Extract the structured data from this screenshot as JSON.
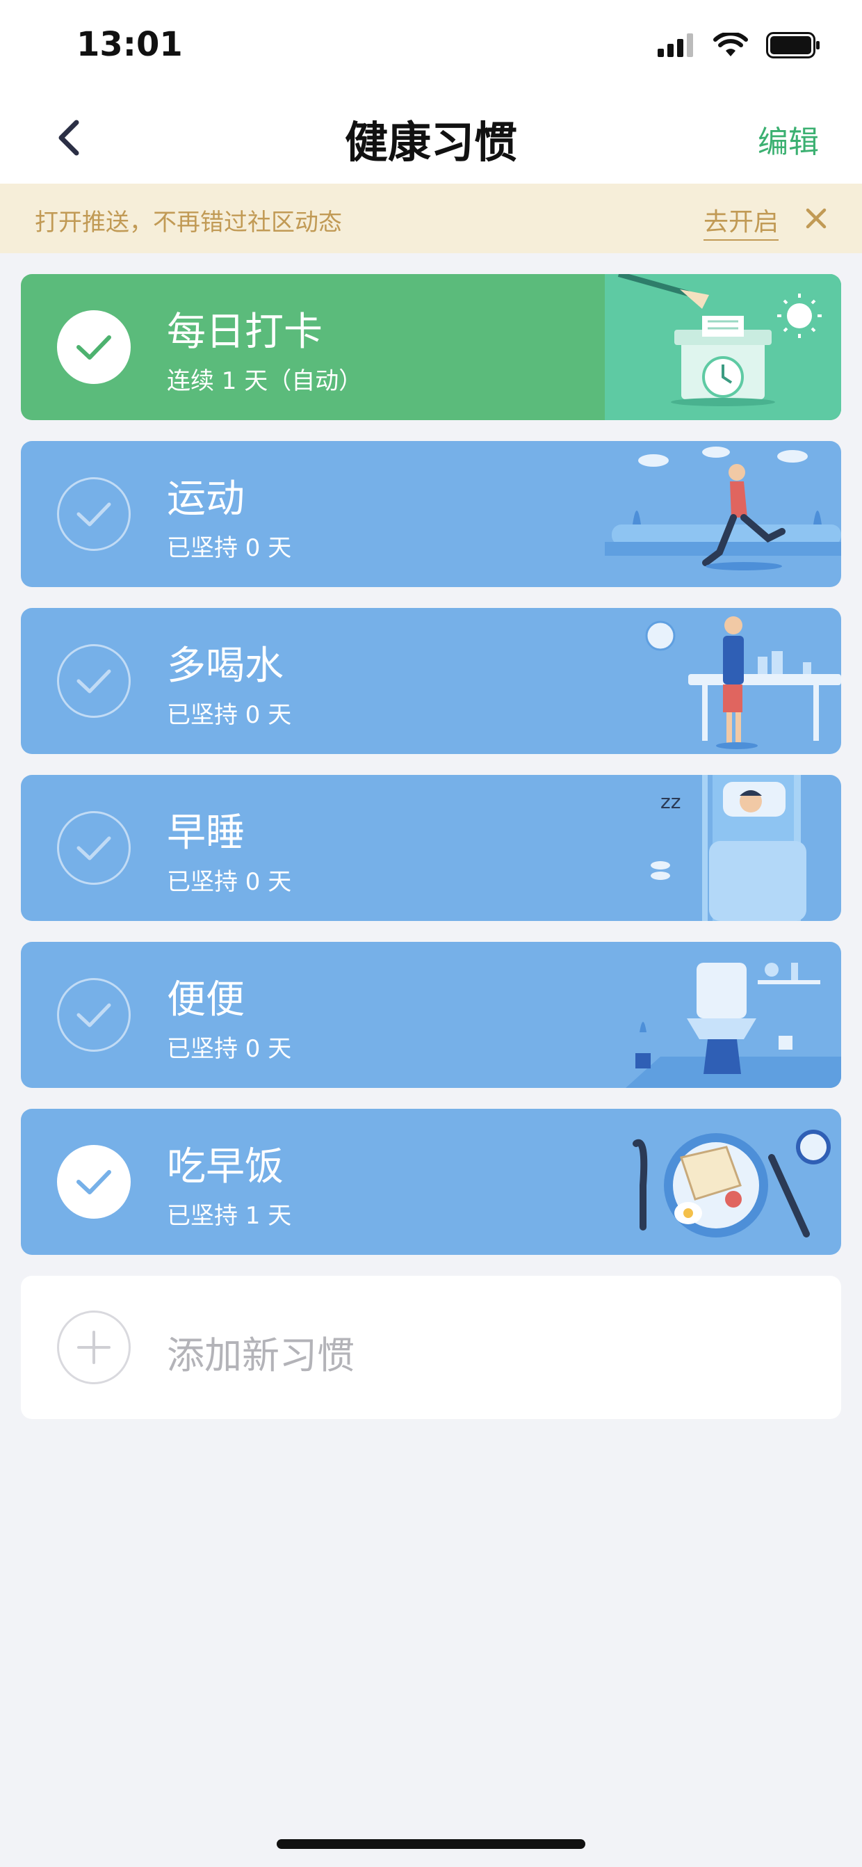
{
  "status_bar": {
    "time": "13:01"
  },
  "nav": {
    "title": "健康习惯",
    "edit_label": "编辑"
  },
  "push_banner": {
    "text": "打开推送，不再错过社区动态",
    "open_label": "去开启"
  },
  "habits": [
    {
      "title": "每日打卡",
      "subtitle": "连续 1 天（自动）",
      "done": true,
      "color": "#5bbb7b",
      "illustration": "clock-box-icon"
    },
    {
      "title": "运动",
      "subtitle": "已坚持 0 天",
      "done": false,
      "color": "#76b0e8",
      "illustration": "runner-icon"
    },
    {
      "title": "多喝水",
      "subtitle": "已坚持 0 天",
      "done": false,
      "color": "#76b0e8",
      "illustration": "drinking-person-icon"
    },
    {
      "title": "早睡",
      "subtitle": "已坚持 0 天",
      "done": false,
      "color": "#76b0e8",
      "illustration": "sleeping-bed-icon"
    },
    {
      "title": "便便",
      "subtitle": "已坚持 0 天",
      "done": false,
      "color": "#76b0e8",
      "illustration": "toilet-icon"
    },
    {
      "title": "吃早饭",
      "subtitle": "已坚持 1 天",
      "done": true,
      "color": "#76b0e8",
      "illustration": "breakfast-plate-icon"
    }
  ],
  "add_habit": {
    "label": "添加新习惯"
  },
  "colors": {
    "accent_green": "#3bb071",
    "card_blue": "#76b0e8",
    "card_green": "#5bbb7b",
    "banner_text": "#c19a55"
  }
}
